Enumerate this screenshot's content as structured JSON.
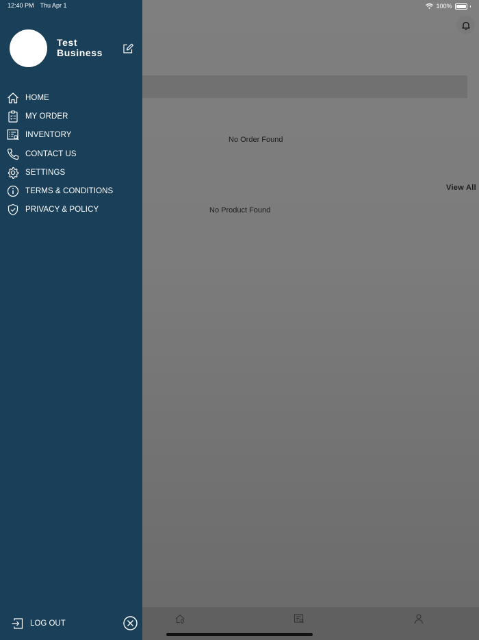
{
  "status_bar": {
    "time": "12:40 PM",
    "date": "Thu Apr 1",
    "battery": "100%"
  },
  "background": {
    "no_order_text": "No Order Found",
    "no_product_text": "No Product Found",
    "view_all_label": "View All"
  },
  "drawer": {
    "business_name": "Test Business",
    "menu": [
      {
        "label": "HOME",
        "icon": "home-icon"
      },
      {
        "label": "MY ORDER",
        "icon": "clipboard-icon"
      },
      {
        "label": "INVENTORY",
        "icon": "inventory-icon"
      },
      {
        "label": "CONTACT US",
        "icon": "phone-icon"
      },
      {
        "label": "SETTINGS",
        "icon": "gear-icon"
      },
      {
        "label": "TERMS & CONDITIONS",
        "icon": "info-icon"
      },
      {
        "label": "PRIVACY & POLICY",
        "icon": "shield-check-icon"
      }
    ],
    "logout_label": "LOG OUT"
  },
  "colors": {
    "drawer_bg": "#1a3f58",
    "overlay": "#7f7f7f"
  }
}
